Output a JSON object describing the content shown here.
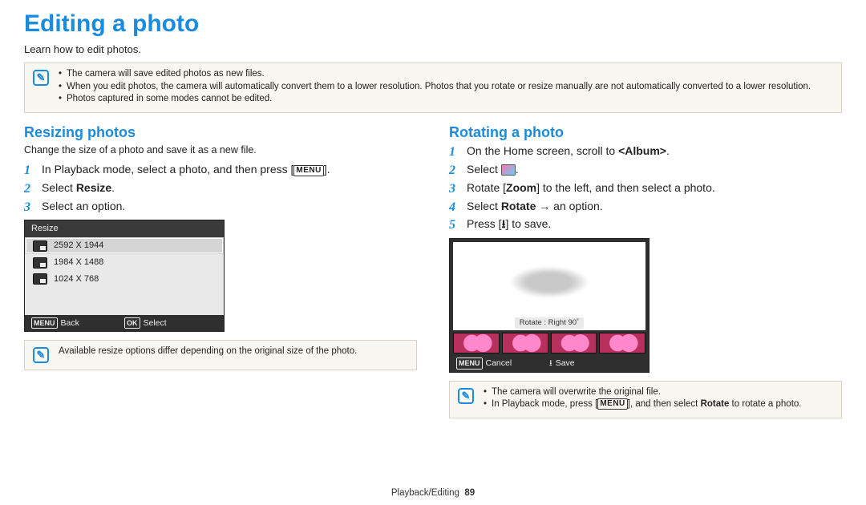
{
  "title": "Editing a photo",
  "subtitle": "Learn how to edit photos.",
  "topbox": {
    "icon_glyph": "✎",
    "items": [
      "The camera will save edited photos as new files.",
      "When you edit photos, the camera will automatically convert them to a lower resolution. Photos that you rotate or resize manually are not automatically converted to a lower resolution.",
      "Photos captured in some modes cannot be edited."
    ]
  },
  "left": {
    "heading": "Resizing photos",
    "sub": "Change the size of a photo and save it as a new file.",
    "step1_pre": "In Playback mode, select a photo, and then press [",
    "step1_post": "].",
    "menu_token": "MENU",
    "step2_pre": "Select ",
    "step2_bold": "Resize",
    "step2_post": ".",
    "step3": "Select an option.",
    "dialog": {
      "title": "Resize",
      "rows": [
        "2592 X 1944",
        "1984 X 1488",
        "1024 X 768"
      ],
      "back_tag": "MENU",
      "back_label": "Back",
      "ok_tag": "OK",
      "select_label": "Select"
    },
    "note_icon_glyph": "✎",
    "note_single": "Available resize options differ depending on the original size of the photo."
  },
  "right": {
    "heading": "Rotating a photo",
    "step1_pre": "On the Home screen, scroll to ",
    "step1_bold": "<Album>",
    "step1_post": ".",
    "step2_pre": "Select ",
    "step2_post": ".",
    "step3_pre": "Rotate [",
    "step3_bold": "Zoom",
    "step3_mid": "] to the left, and then select a photo.",
    "step4_pre": "Select ",
    "step4_bold": "Rotate",
    "step4_mid": " → an option.",
    "step5_pre": "Press [",
    "step5_glyph": "⭳",
    "step5_post": "] to save.",
    "preview": {
      "caption": "Rotate : Right 90˚",
      "cancel_tag": "MENU",
      "cancel_label": "Cancel",
      "save_glyph": "⭳",
      "save_label": "Save"
    },
    "notebox": {
      "icon_glyph": "✎",
      "item1": "The camera will overwrite the original file.",
      "item2_pre": "In Playback mode, press [",
      "item2_menu": "MENU",
      "item2_mid": "], and then select ",
      "item2_bold": "Rotate",
      "item2_post": " to rotate a photo."
    }
  },
  "footer": {
    "section": "Playback/Editing",
    "page": "89"
  }
}
